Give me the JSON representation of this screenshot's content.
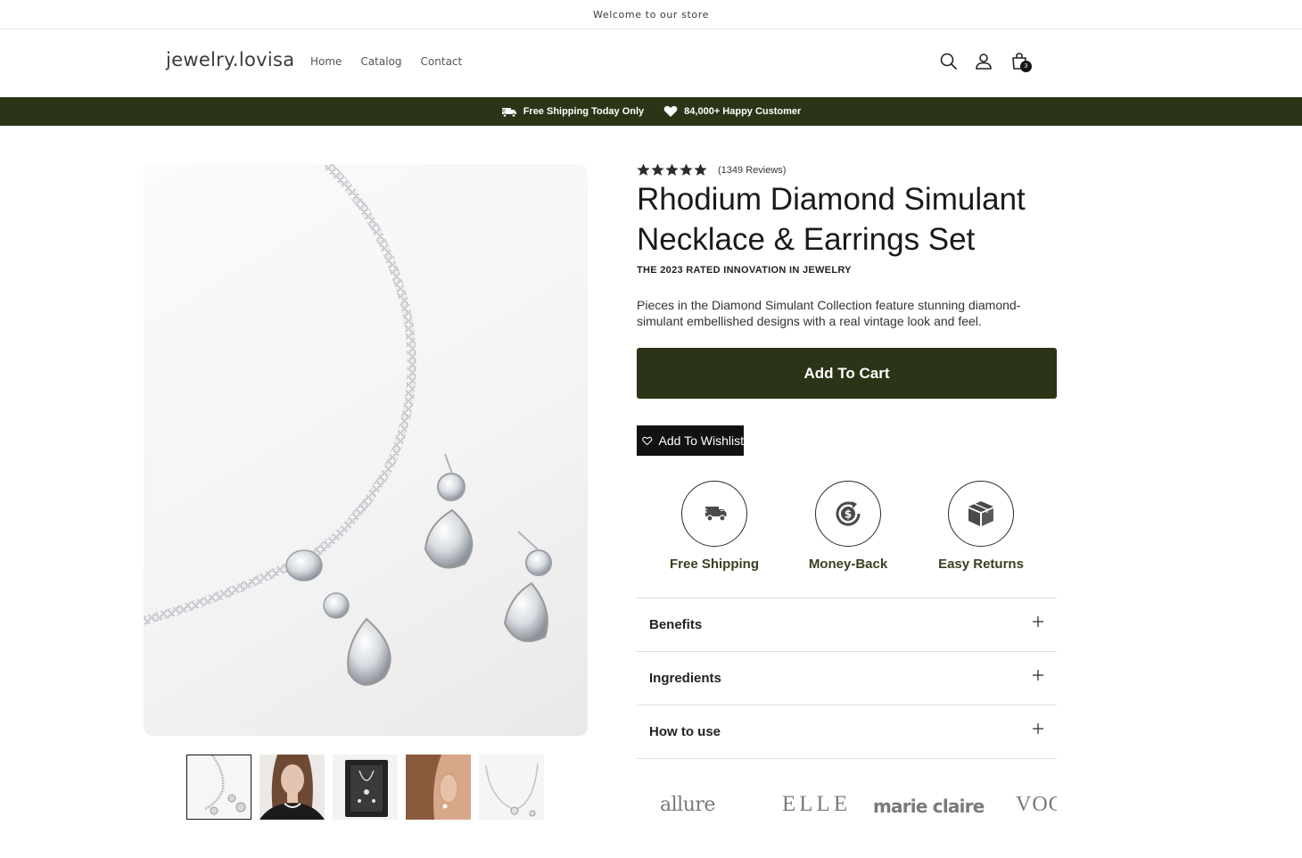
{
  "announcement": "Welcome to our store",
  "header": {
    "logo": "jewelry.lovisa",
    "nav": [
      "Home",
      "Catalog",
      "Contact"
    ],
    "cart_count": "3"
  },
  "promo": {
    "shipping": "Free Shipping Today Only",
    "customers": "84,000+ Happy Customer"
  },
  "product": {
    "rating_stars": 5,
    "reviews": "(1349 Reviews)",
    "title": "Rhodium Diamond Simulant Necklace & Earrings Set",
    "subheading": "THE 2023 RATED INNOVATION IN JEWELRY",
    "description": "Pieces in the Diamond Simulant Collection feature stunning diamond-simulant embellished designs with a real vintage look and feel.",
    "add_to_cart": "Add To Cart",
    "wishlist": "Add To Wishlist"
  },
  "features": [
    {
      "label": "Free Shipping",
      "icon": "truck-icon"
    },
    {
      "label": "Money-Back",
      "icon": "money-back-icon"
    },
    {
      "label": "Easy Returns",
      "icon": "box-icon"
    }
  ],
  "accordion": [
    "Benefits",
    "Ingredients",
    "How to use"
  ],
  "brands": [
    "allure",
    "ELLE",
    "marie claire",
    "VOGUE"
  ],
  "colors": {
    "accent": "#2b3417",
    "text": "#121212",
    "feature_label": "#3a4020"
  }
}
